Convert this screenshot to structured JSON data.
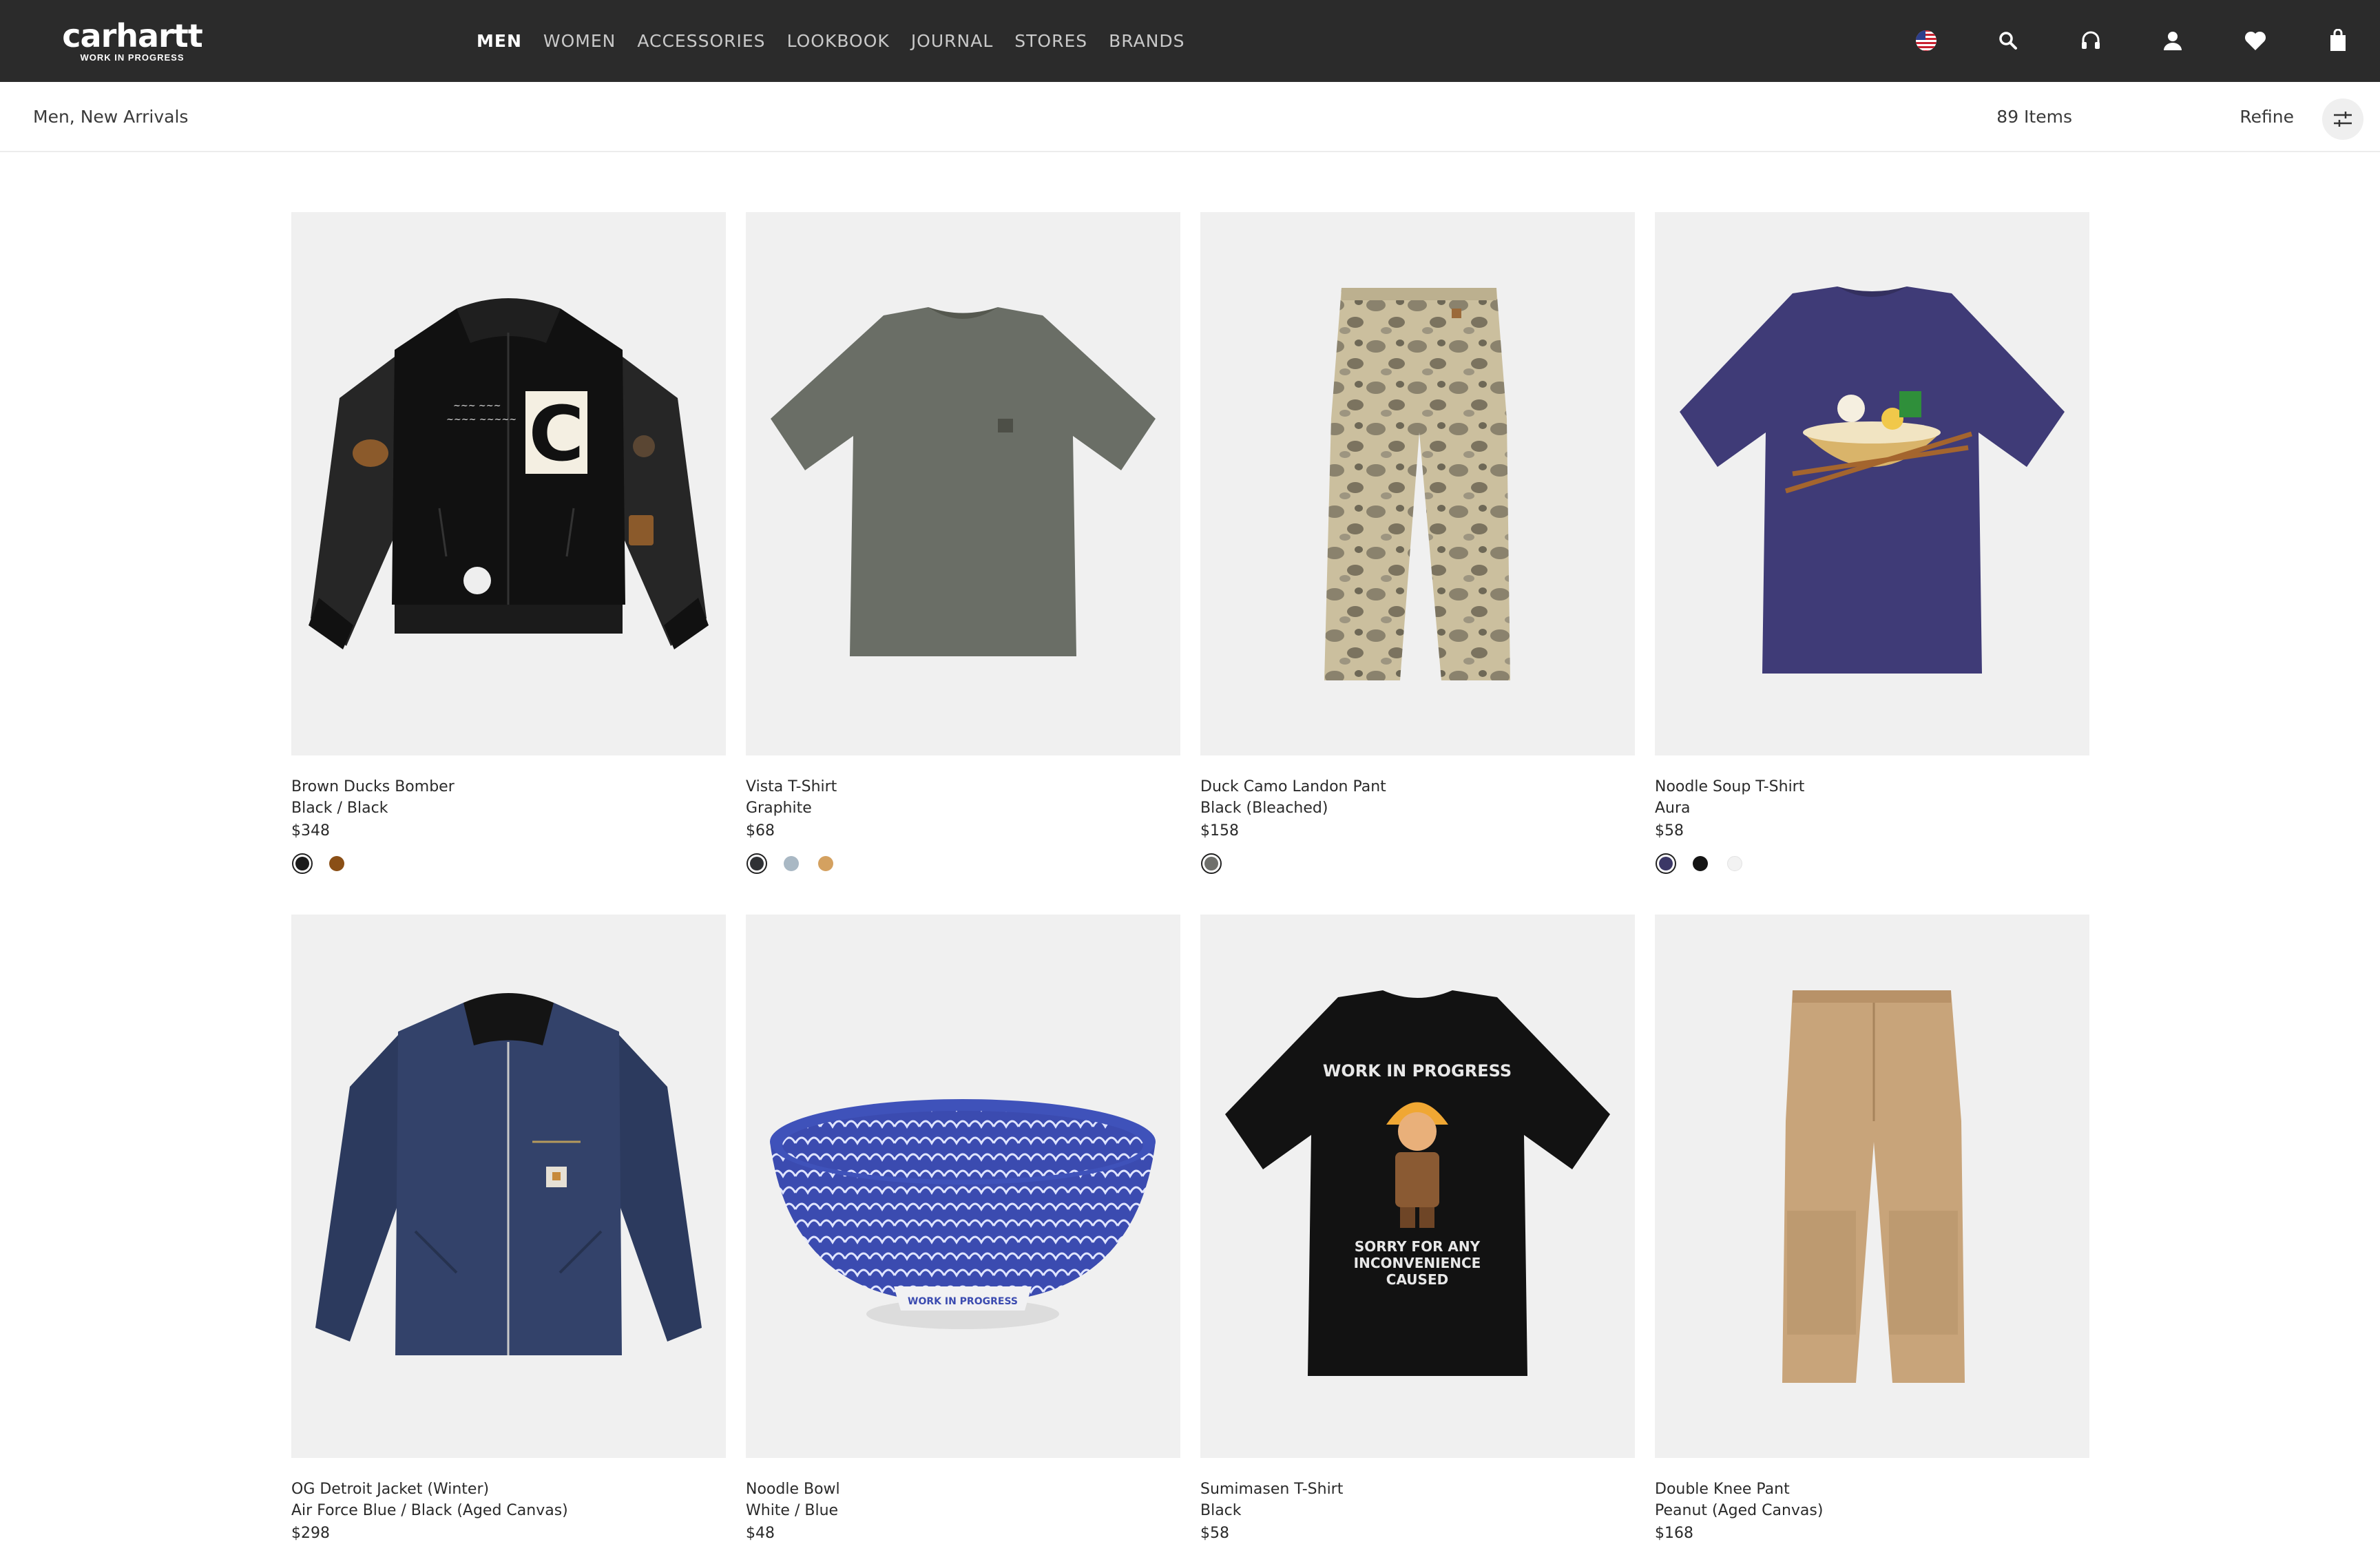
{
  "header": {
    "logo_main": "carhartt",
    "logo_sub": "WORK IN PROGRESS",
    "nav": [
      {
        "label": "MEN",
        "active": true
      },
      {
        "label": "WOMEN",
        "active": false
      },
      {
        "label": "ACCESSORIES",
        "active": false
      },
      {
        "label": "LOOKBOOK",
        "active": false
      },
      {
        "label": "JOURNAL",
        "active": false
      },
      {
        "label": "STORES",
        "active": false
      },
      {
        "label": "BRANDS",
        "active": false
      }
    ],
    "icons": [
      "us-flag-icon",
      "search-icon",
      "headset-icon",
      "account-icon",
      "wishlist-heart-icon",
      "shopping-bag-icon"
    ]
  },
  "subbar": {
    "breadcrumb": "Men, New Arrivals",
    "items_count": "89 Items",
    "refine_label": "Refine"
  },
  "products": [
    {
      "name": "Brown Ducks Bomber",
      "color": "Black / Black",
      "price": "$348",
      "swatches": [
        "#1a1a1a",
        "#8a4f16"
      ],
      "image": "varsity-bomber-jacket"
    },
    {
      "name": "Vista T-Shirt",
      "color": "Graphite",
      "price": "$68",
      "swatches": [
        "#2f3134",
        "#a9b8c4",
        "#d4a160"
      ],
      "image": "grey-tshirt"
    },
    {
      "name": "Duck Camo Landon Pant",
      "color": "Black (Bleached)",
      "price": "$158",
      "swatches": [
        "#6f706c"
      ],
      "image": "camo-pant"
    },
    {
      "name": "Noodle Soup T-Shirt",
      "color": "Aura",
      "price": "$58",
      "swatches": [
        "#3b3766",
        "#141414",
        "#f2f2f2"
      ],
      "image": "purple-graphic-tshirt"
    },
    {
      "name": "OG Detroit Jacket (Winter)",
      "color": "Air Force Blue / Black (Aged Canvas)",
      "price": "$298",
      "swatches": [],
      "image": "navy-detroit-jacket"
    },
    {
      "name": "Noodle Bowl",
      "color": "White / Blue",
      "price": "$48",
      "swatches": [],
      "image": "blue-patterned-bowl"
    },
    {
      "name": "Sumimasen T-Shirt",
      "color": "Black",
      "price": "$58",
      "swatches": [],
      "image": "black-graphic-tshirt"
    },
    {
      "name": "Double Knee Pant",
      "color": "Peanut (Aged Canvas)",
      "price": "$168",
      "swatches": [],
      "image": "tan-double-knee-pant"
    }
  ],
  "product_print": {
    "sumimasen_top": "WORK IN PROGRESS",
    "sumimasen_bottom": "SORRY FOR ANY INCONVENIENCE CAUSED",
    "bowl_base": "WORK IN PROGRESS",
    "bomber_letter": "C"
  }
}
